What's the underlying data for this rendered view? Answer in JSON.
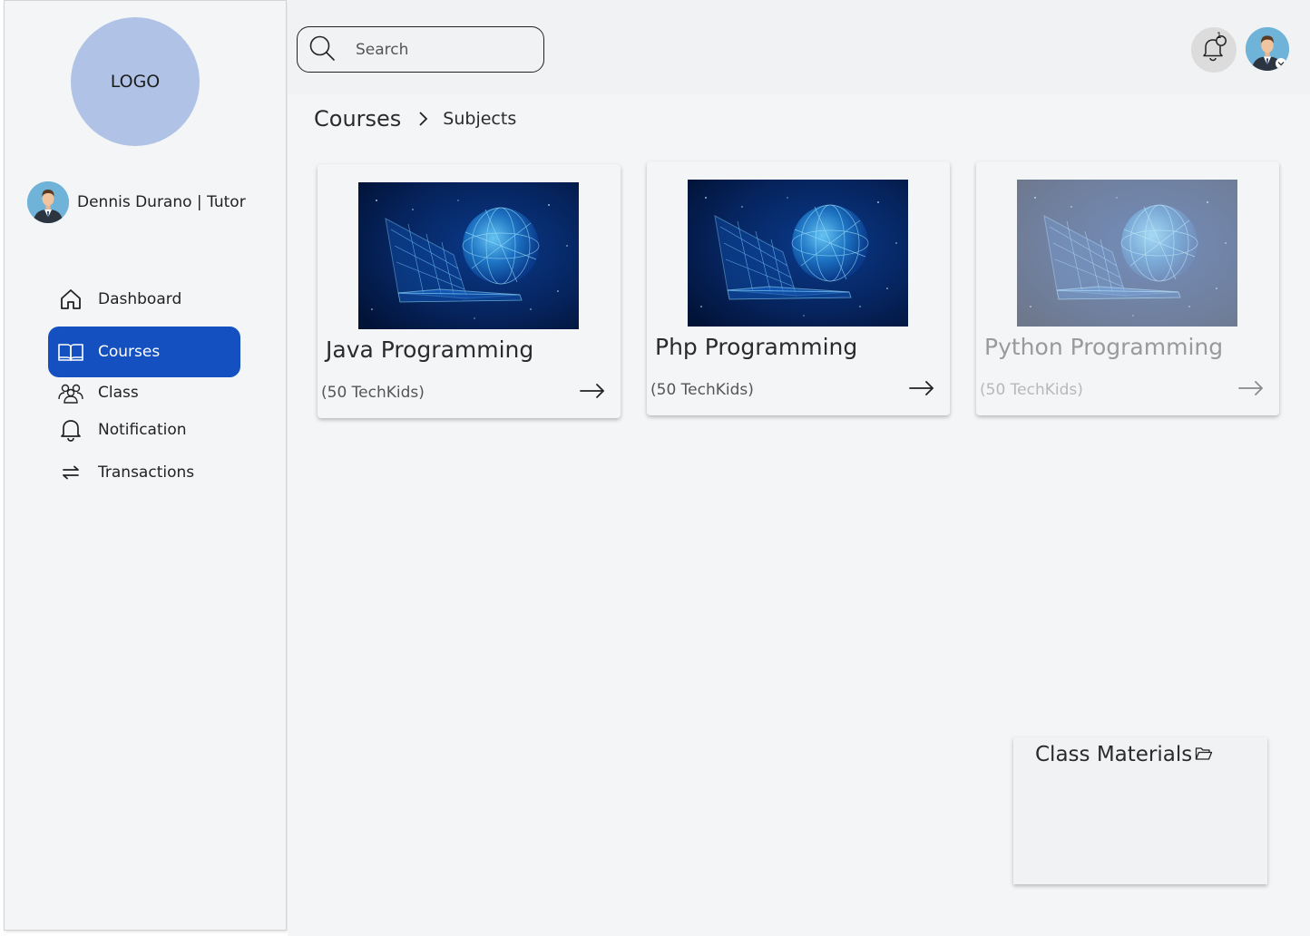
{
  "sidebar": {
    "logo_text": "LOGO",
    "profile": {
      "name": "Dennis Durano | Tutor"
    },
    "items": [
      {
        "label": "Dashboard",
        "icon": "home-icon",
        "active": false
      },
      {
        "label": "Courses",
        "icon": "book-icon",
        "active": true
      },
      {
        "label": "Class",
        "icon": "users-icon",
        "active": false
      },
      {
        "label": "Notification",
        "icon": "bell-icon",
        "active": false
      },
      {
        "label": "Transactions",
        "icon": "swap-arrows-icon",
        "active": false
      }
    ]
  },
  "header": {
    "search": {
      "placeholder": "Search",
      "value": ""
    },
    "notification": {
      "icon": "bell-icon",
      "badge": "1"
    },
    "avatar": "user-avatar"
  },
  "breadcrumb": {
    "items": [
      "Courses",
      "Subjects"
    ]
  },
  "courses": [
    {
      "title": "Java Programming",
      "count": "(50 TechKids)",
      "state": "normal"
    },
    {
      "title": "Php Programming",
      "count": "(50 TechKids)",
      "state": "normal"
    },
    {
      "title": "Python Programming",
      "count": "(50 TechKids)",
      "state": "faded"
    }
  ],
  "materials": {
    "title": "Class Materials",
    "icon": "folder-open-icon"
  },
  "colors": {
    "accent": "#1450c0",
    "logo_bg": "#b0c3e6",
    "background": "#f4f5f6"
  }
}
